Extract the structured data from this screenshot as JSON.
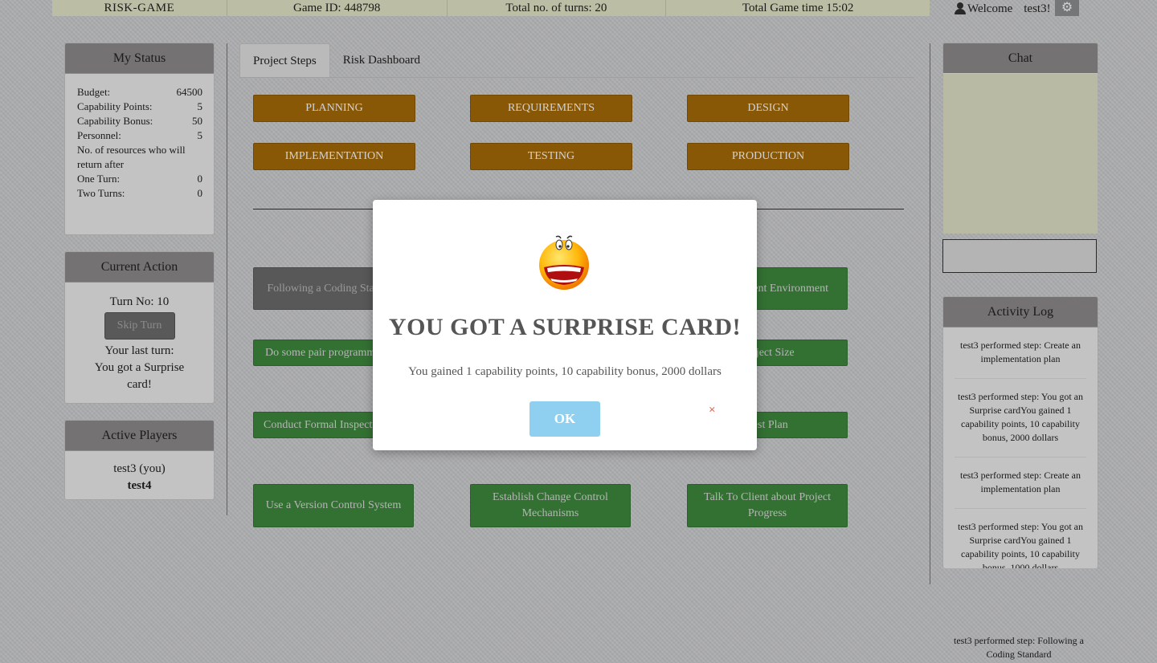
{
  "topbar": {
    "app_name": "RISK-GAME",
    "game_id": "Game ID: 448798",
    "total_turns": "Total no. of turns: 20",
    "total_time": "Total Game time 15:02",
    "welcome": "Welcome",
    "username": "test3!"
  },
  "my_status": {
    "title": "My Status",
    "rows": [
      {
        "label": "Budget:",
        "value": "64500"
      },
      {
        "label": "Capability Points:",
        "value": "5"
      },
      {
        "label": "Capability Bonus:",
        "value": "50"
      },
      {
        "label": "Personnel:",
        "value": "5"
      },
      {
        "label": "No. of resources who will return after",
        "value": ""
      },
      {
        "label": "One Turn:",
        "value": "0"
      },
      {
        "label": "Two Turns:",
        "value": "0"
      }
    ]
  },
  "current_action": {
    "title": "Current Action",
    "turn_no": "Turn No: 10",
    "skip_button": "Skip Turn",
    "last_turn_label": "Your last turn:",
    "last_turn_text": "You got a Surprise card!"
  },
  "active_players": {
    "title": "Active Players",
    "players": [
      "test3 (you)",
      "test4"
    ]
  },
  "tabs": [
    "Project Steps",
    "Risk Dashboard"
  ],
  "phases": [
    "PLANNING",
    "REQUIREMENTS",
    "DESIGN",
    "IMPLEMENTATION",
    "TESTING",
    "PRODUCTION"
  ],
  "steps": [
    "Following a Coding Standard",
    "Development Environment",
    "Do some pair programming",
    "Project Size",
    "Conduct Formal Inspection",
    "Test Plan",
    "Use a Version Control System",
    "Establish Change Control Mechanisms",
    "Talk To Client about Project Progress"
  ],
  "chat": {
    "title": "Chat"
  },
  "activity_log": {
    "title": "Activity Log",
    "items": [
      "test3 performed step: Create an implementation plan",
      "test3 performed step: You got an Surprise cardYou gained 1 capability points, 10 capability bonus, 2000 dollars",
      "test3 performed step: Create an implementation plan",
      "test3 performed step: You got an Surprise cardYou gained 1 capability points, 10 capability bonus, 1000 dollars",
      "test3 performed step: Following a Coding Standard"
    ]
  },
  "modal": {
    "title": "YOU GOT A SURPRISE CARD!",
    "message": "You gained 1 capability points, 10 capability bonus, 2000 dollars",
    "ok_label": "OK",
    "close_label": "×"
  }
}
